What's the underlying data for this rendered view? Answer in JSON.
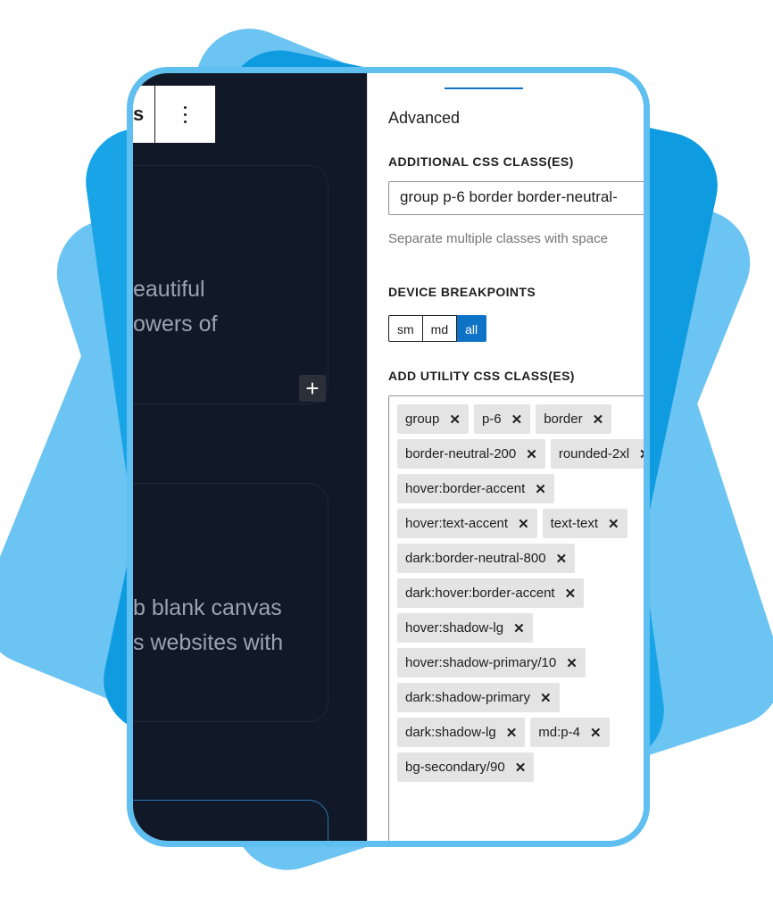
{
  "editor": {
    "card1_text_lines": [
      "eautiful",
      "owers of"
    ],
    "card2_text_lines": [
      "b blank canvas",
      "s websites with"
    ],
    "plus_symbol": "+",
    "toolbar_left_glyph": "s"
  },
  "panel": {
    "title": "Advanced",
    "css_label": "ADDITIONAL CSS CLASS(ES)",
    "css_value": "group p-6 border border-neutral-",
    "css_help": "Separate multiple classes with space",
    "breakpoints_label": "DEVICE BREAKPOINTS",
    "breakpoints": [
      "sm",
      "md",
      "all"
    ],
    "breakpoint_selected": "all",
    "utility_label": "ADD UTILITY CSS CLASS(ES)",
    "tokens": [
      "group",
      "p-6",
      "border",
      "border-neutral-200",
      "rounded-2xl",
      "hover:border-accent",
      "hover:text-accent",
      "text-text",
      "dark:border-neutral-800",
      "dark:hover:border-accent",
      "hover:shadow-lg",
      "hover:shadow-primary/10",
      "dark:shadow-primary",
      "dark:shadow-lg",
      "md:p-4",
      "bg-secondary/90"
    ],
    "remove_glyph": "✕"
  },
  "colors": {
    "accent": "#0e72c7",
    "editor_bg": "#111827",
    "frame": "#5fbff0"
  }
}
